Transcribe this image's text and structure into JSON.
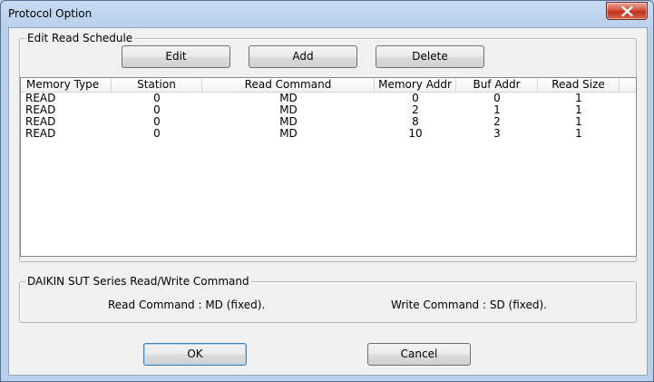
{
  "window": {
    "title": "Protocol Option"
  },
  "read_schedule": {
    "group_label": "Edit Read Schedule",
    "buttons": {
      "edit": "Edit",
      "add": "Add",
      "delete": "Delete"
    },
    "columns": [
      "Memory Type",
      "Station",
      "Read Command",
      "Memory Addr",
      "Buf Addr",
      "Read Size"
    ],
    "rows": [
      [
        "READ",
        "0",
        "MD",
        "0",
        "0",
        "1"
      ],
      [
        "READ",
        "0",
        "MD",
        "2",
        "1",
        "1"
      ],
      [
        "READ",
        "0",
        "MD",
        "8",
        "2",
        "1"
      ],
      [
        "READ",
        "0",
        "MD",
        "10",
        "3",
        "1"
      ]
    ]
  },
  "command_info": {
    "group_label": "DAIKIN SUT Series Read/Write Command",
    "read_text": "Read Command : MD (fixed).",
    "write_text": "Write Command : SD (fixed)."
  },
  "dialog_buttons": {
    "ok": "OK",
    "cancel": "Cancel"
  },
  "colors": {
    "close_button": "#c1311c",
    "title_bar": "#b9d0ec"
  }
}
